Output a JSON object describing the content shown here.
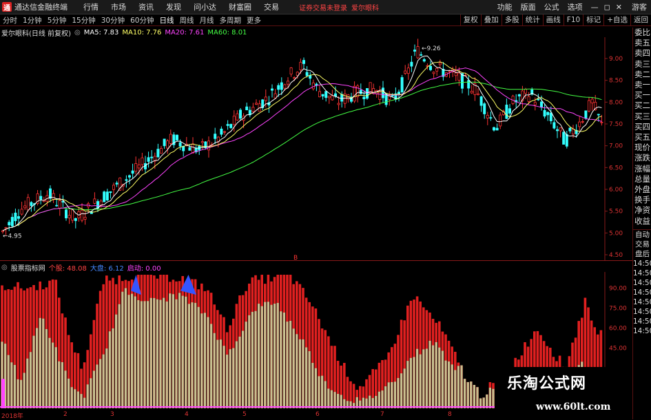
{
  "titlebar": {
    "app_title": "通达信金融终端",
    "menus": [
      "行情",
      "市场",
      "资讯",
      "发现",
      "问小达",
      "财富圈",
      "交易"
    ],
    "notice": "证券交易未登录",
    "stock_link": "爱尔眼科",
    "right_menus": [
      "功能",
      "版面",
      "公式",
      "选项"
    ],
    "guest": "游客"
  },
  "tabs": {
    "periods": [
      "分时",
      "1分钟",
      "5分钟",
      "15分钟",
      "30分钟",
      "60分钟",
      "日线",
      "周线",
      "月线",
      "多周期",
      "更多"
    ],
    "active": "日线",
    "tools": [
      "复权",
      "叠加",
      "多股",
      "统计",
      "画线",
      "F10",
      "标记",
      "+自选",
      "返回"
    ]
  },
  "main_chart": {
    "stock_name": "爱尔眼科(日线 前复权)",
    "ma": [
      {
        "label": "MA5: 7.83",
        "color": "#ffffff"
      },
      {
        "label": "MA10: 7.76",
        "color": "#ffff66"
      },
      {
        "label": "MA20: 7.61",
        "color": "#ff44ff"
      },
      {
        "label": "MA60: 8.01",
        "color": "#44ff44"
      }
    ],
    "high_label": "9.26",
    "low_label": "4.95",
    "y_ticks": [
      "9.00",
      "8.50",
      "8.00",
      "7.50",
      "7.00",
      "6.50",
      "6.00",
      "5.50",
      "5.00",
      "4.50"
    ],
    "marker": "B"
  },
  "sub_chart": {
    "name": "股票指标网",
    "items": [
      {
        "label": "个股: 48.08",
        "color": "#ff4444"
      },
      {
        "label": "大盘: 6.12",
        "color": "#4488ff"
      },
      {
        "label": "启动: 0.00",
        "color": "#ff44ff"
      }
    ],
    "y_ticks": [
      "90.00",
      "75.00",
      "60.00",
      "45.00"
    ]
  },
  "x_axis": {
    "labels": [
      "2018年",
      "2",
      "3",
      "4",
      "5",
      "6",
      "7",
      "8"
    ]
  },
  "right_panel": {
    "labels": [
      "委比",
      "卖五",
      "卖四",
      "卖三",
      "卖二",
      "卖一",
      "买一",
      "买二",
      "买三",
      "买四",
      "买五",
      "现价",
      "涨跌",
      "涨幅",
      "总量",
      "外盘",
      "换手",
      "净资",
      "收益"
    ],
    "labels2": [
      "自动",
      "交易",
      "盘后",
      "14:50",
      "14:50",
      "14:50",
      "14:50",
      "14:50",
      "14:50",
      "14:50",
      "14:50"
    ]
  },
  "chart_data": {
    "type": "candlestick",
    "title": "爱尔眼科(日线 前复权)",
    "y_range": [
      4.5,
      9.3
    ],
    "points": [
      {
        "x": "2018-01",
        "close": 5.0
      },
      {
        "x": "2018-01b",
        "close": 5.5
      },
      {
        "x": "2018-01c",
        "close": 5.9
      },
      {
        "x": "2018-02",
        "close": 5.6
      },
      {
        "x": "2018-02b",
        "close": 5.3
      },
      {
        "x": "2018-02c",
        "close": 5.8
      },
      {
        "x": "2018-03",
        "close": 6.2
      },
      {
        "x": "2018-03b",
        "close": 6.8
      },
      {
        "x": "2018-03c",
        "close": 7.0
      },
      {
        "x": "2018-04",
        "close": 6.9
      },
      {
        "x": "2018-04b",
        "close": 7.2
      },
      {
        "x": "2018-04c",
        "close": 7.4
      },
      {
        "x": "2018-05",
        "close": 7.7
      },
      {
        "x": "2018-05b",
        "close": 8.1
      },
      {
        "x": "2018-05c",
        "close": 8.6
      },
      {
        "x": "2018-06",
        "close": 8.2
      },
      {
        "x": "2018-06b",
        "close": 7.9
      },
      {
        "x": "2018-06c",
        "close": 8.2
      },
      {
        "x": "2018-07",
        "close": 8.5
      },
      {
        "x": "2018-07b",
        "close": 9.2
      },
      {
        "x": "2018-07c",
        "close": 8.6
      },
      {
        "x": "2018-08",
        "close": 8.2
      },
      {
        "x": "2018-08b",
        "close": 7.5
      },
      {
        "x": "2018-08c",
        "close": 7.8
      }
    ]
  },
  "watermark": {
    "line1": "乐淘公式网",
    "line2": "www.60lt.com"
  }
}
